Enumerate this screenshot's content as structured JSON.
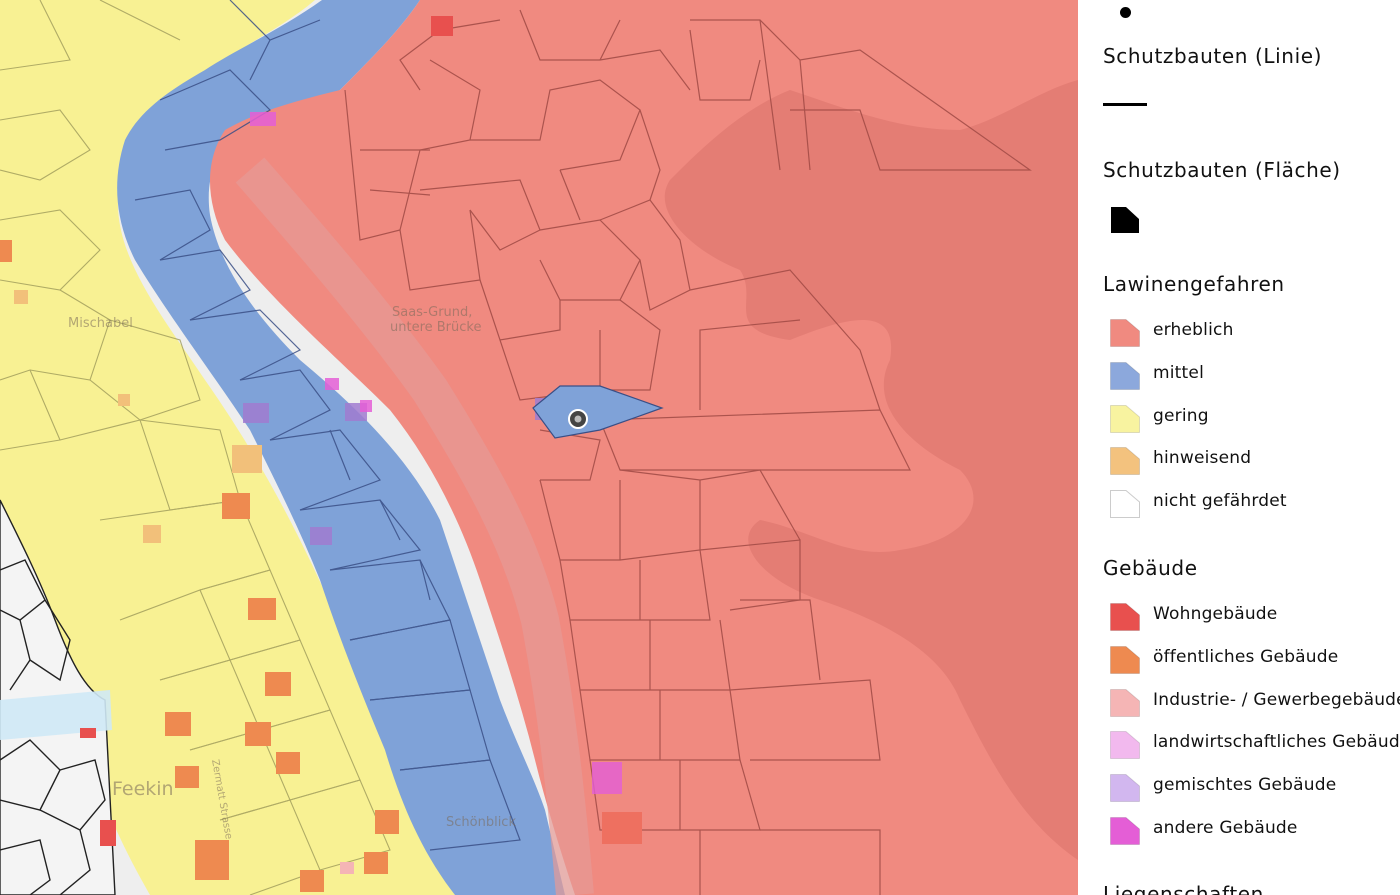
{
  "map": {
    "place_labels": {
      "saas_grund": "Saas-Grund,",
      "untere_brucke": "untere Brücke",
      "mischabel": "Mischabel",
      "feekin": "Feekin",
      "schonblick": "Schönblick",
      "zermatt_road": "Zermatt Strasse"
    },
    "colors": {
      "erheblich": "#f08a80",
      "mittel": "#7fa2d8",
      "gering": "#f8f193",
      "hinweisend": "#f2c07a",
      "parcel_line": "#a04a45",
      "wohngebaude": "#e8504e",
      "offentlich": "#ee8a50"
    },
    "marker_icon": "map-pin-marker-icon"
  },
  "legend": {
    "point_symbol": "point-symbol-icon",
    "schutzbauten_linie": {
      "title": "Schutzbauten (Linie)",
      "symbol": "line-symbol-icon"
    },
    "schutzbauten_flache": {
      "title": "Schutzbauten (Fläche)",
      "symbol": "polygon-symbol-icon"
    },
    "lawinengefahren": {
      "title": "Lawinengefahren",
      "items": [
        {
          "label": "erheblich",
          "color": "#f08a80"
        },
        {
          "label": "mittel",
          "color": "#8ca8dc"
        },
        {
          "label": "gering",
          "color": "#f8f3a0"
        },
        {
          "label": "hinweisend",
          "color": "#f3c27e"
        },
        {
          "label": "nicht gefährdet",
          "color": "#ffffff"
        }
      ]
    },
    "gebaude": {
      "title": "Gebäude",
      "items": [
        {
          "label": "Wohngebäude",
          "color": "#e8504e"
        },
        {
          "label": "öffentliches Gebäude",
          "color": "#ee8a50"
        },
        {
          "label": "Industrie- / Gewerbegebäude",
          "color": "#f5b5b5"
        },
        {
          "label": "landwirtschaftliches Gebäude",
          "color": "#f2b9ee"
        },
        {
          "label": "gemischtes Gebäude",
          "color": "#d2b7ef"
        },
        {
          "label": "andere Gebäude",
          "color": "#e45ed6"
        }
      ]
    },
    "liegenschaften": {
      "title": "Liegenschaften"
    }
  }
}
